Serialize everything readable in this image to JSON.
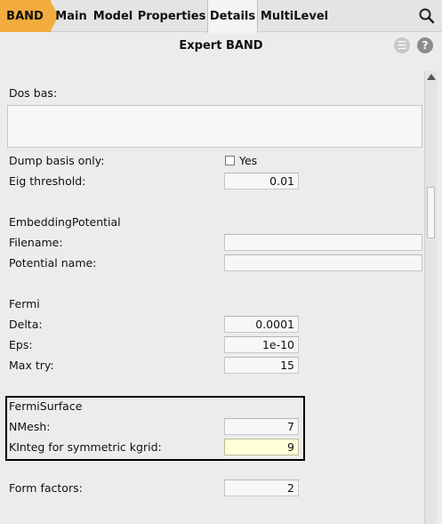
{
  "tabs": {
    "band": "BAND",
    "main": "Main",
    "model": "Model",
    "properties": "Properties",
    "details": "Details",
    "multilevel": "MultiLevel"
  },
  "title": "Expert BAND",
  "buttons": {
    "menu": "☰",
    "help": "?"
  },
  "dos_basis": {
    "label": "Dos bas:"
  },
  "dump_basis": {
    "label": "Dump basis only:",
    "checkbox_label": "Yes",
    "checked": false
  },
  "eig_threshold": {
    "label": "Eig threshold:",
    "value": "0.01"
  },
  "embedding": {
    "section": "EmbeddingPotential",
    "filename_label": "Filename:",
    "filename_value": "",
    "potential_label": "Potential name:",
    "potential_value": ""
  },
  "fermi": {
    "section": "Fermi",
    "delta_label": "Delta:",
    "delta_value": "0.0001",
    "eps_label": "Eps:",
    "eps_value": "1e-10",
    "maxtry_label": "Max try:",
    "maxtry_value": "15"
  },
  "fermisurface": {
    "section": "FermiSurface",
    "nmesh_label": "NMesh:",
    "nmesh_value": "7",
    "kinteg_label": "KInteg for symmetric kgrid:",
    "kinteg_value": "9"
  },
  "form_factors": {
    "label": "Form factors:",
    "value": "2"
  },
  "colors": {
    "accent": "#f2ad3e",
    "focus_field": "#ffffd8"
  }
}
